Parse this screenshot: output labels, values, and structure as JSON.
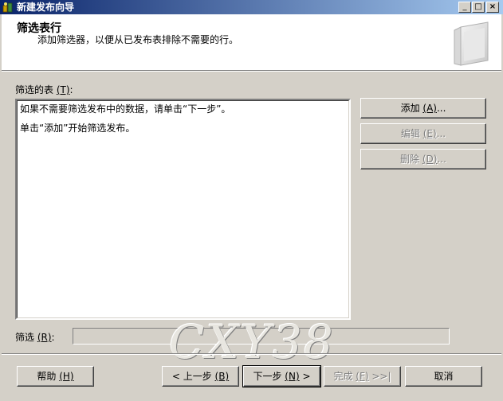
{
  "window": {
    "title": "新建发布向导",
    "minimize_glyph": "_",
    "maximize_glyph": "□",
    "close_glyph": "×"
  },
  "header": {
    "title": "筛选表行",
    "subtitle": "添加筛选器，以便从已发布表排除不需要的行。"
  },
  "tables_label": {
    "text": "筛选的表 ",
    "mnemonic": "(T)",
    "suffix": ":"
  },
  "list": {
    "lines": [
      "如果不需要筛选发布中的数据，请单击“下一步”。",
      "单击“添加”开始筛选发布。"
    ]
  },
  "side_buttons": {
    "add": {
      "text": "添加 ",
      "mnemonic": "(A)",
      "suffix": "..."
    },
    "edit": {
      "text": "编辑 ",
      "mnemonic": "(E)",
      "suffix": "..."
    },
    "delete": {
      "text": "删除 ",
      "mnemonic": "(D)",
      "suffix": "..."
    }
  },
  "filter_label": {
    "text": "筛选 ",
    "mnemonic": "(R)",
    "suffix": ":"
  },
  "footer_buttons": {
    "help": {
      "text": "帮助 ",
      "mnemonic": "(H)"
    },
    "back": {
      "text": "< 上一步 ",
      "mnemonic": "(B)"
    },
    "next": {
      "text": "下一步 ",
      "mnemonic": "(N)",
      "suffix": " >"
    },
    "finish": {
      "text": "完成 ",
      "mnemonic": "(F)",
      "suffix": " >>|"
    },
    "cancel": {
      "text": "取消"
    }
  },
  "watermark": "CXY38",
  "icons": {
    "title_icon": "wizard-icon",
    "header_art": "book-icon"
  }
}
